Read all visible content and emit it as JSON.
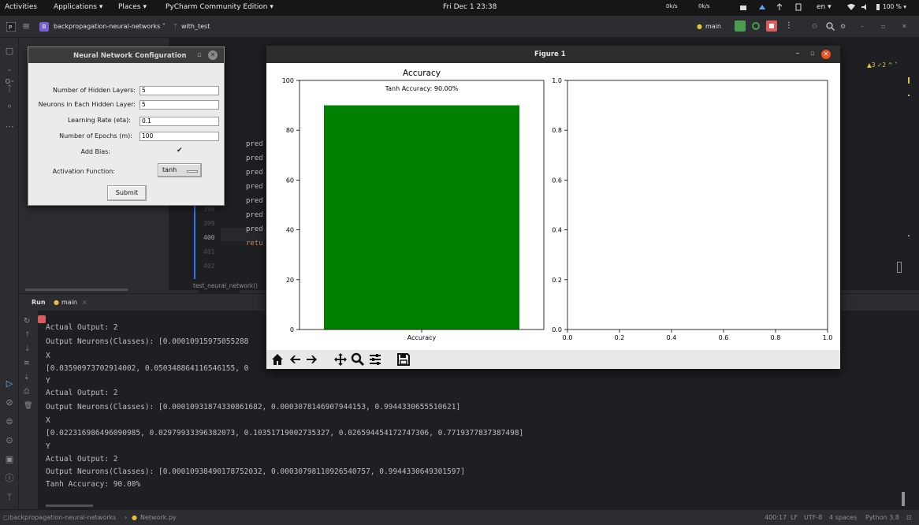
{
  "gnome_bar": {
    "activities": "Activities",
    "applications": "Applications ▾",
    "places": "Places ▾",
    "app": "PyCharm Community Edition ▾",
    "clock": "Fri Dec 1  23:38",
    "net_down": "0k/s",
    "net_up": "0k/s",
    "lang": "en ▾",
    "battery": "100 % ▾"
  },
  "toolbar": {
    "project": "backpropagation-neural-networks",
    "branch": "with_test",
    "run_config": "main",
    "project_badge": "B"
  },
  "editor": {
    "line_numbers": [
      "398",
      "399",
      "400",
      "401",
      "402"
    ],
    "code_lines": [
      "pred",
      "pred",
      "pred",
      "pred",
      "pred",
      "pred",
      "pred",
      "retu"
    ],
    "breadcrumb": "test_neural_network()",
    "inspection": "▲3 ✓2 ^ ˅"
  },
  "run_panel": {
    "run_label": "Run",
    "tab": "main",
    "lines": [
      "Actual Output:  2",
      "Output Neurons(Classes):  [0.00010915975055288",
      "X",
      "[0.03590973702914002, 0.050348864116546155, 0",
      "Y",
      "Actual Output:  2",
      "Output Neurons(Classes):  [0.00010931874330861682, 0.0003078146907944153, 0.9944330655510621]",
      "X",
      "[0.022316986496090985, 0.02979933396382073, 0.10351719002735327, 0.026594454172747306, 0.7719377837387498]",
      "Y",
      "Actual Output:  2",
      "Output Neurons(Classes):  [0.00010938490178752032, 0.00030798110926540757, 0.9944330649301597]",
      "Tanh Accuracy: 90.00%"
    ]
  },
  "status_bar": {
    "path_project": "backpropagation-neural-networks",
    "path_file": "Network.py",
    "position": "400:17",
    "line_sep": "LF",
    "encoding": "UTF-8",
    "indent": "4 spaces",
    "interpreter": "Python 3.8"
  },
  "nn_dialog": {
    "title": "Neural Network Configuration",
    "fields": [
      {
        "label": "Number of Hidden Layers:",
        "value": "5"
      },
      {
        "label": "Neurons in Each Hidden Layer:",
        "value": "5"
      },
      {
        "label": "Learning Rate (eta):",
        "value": "0.1"
      },
      {
        "label": "Number of Epochs (m):",
        "value": "100"
      }
    ],
    "bias_label": "Add Bias:",
    "bias_checked": true,
    "activation_label": "Activation Function:",
    "activation_value": "tanh",
    "submit_label": "Submit"
  },
  "figure": {
    "window_title": "Figure 1",
    "toolbar_icons": [
      "home-icon",
      "back-icon",
      "forward-icon",
      "pan-icon",
      "zoom-icon",
      "configure-icon",
      "save-icon"
    ]
  },
  "chart_data": [
    {
      "type": "bar",
      "title": "Accuracy",
      "subtitle": "Tanh Accuracy: 90.00%",
      "categories": [
        "Accuracy"
      ],
      "values": [
        90
      ],
      "color": "#008000",
      "ylim": [
        0,
        100
      ],
      "yticks": [
        0,
        20,
        40,
        60,
        80,
        100
      ],
      "grid": false
    },
    {
      "type": "line",
      "title": "",
      "xlim": [
        0.0,
        1.0
      ],
      "ylim": [
        0.0,
        1.0
      ],
      "xticks": [
        "0.0",
        "0.2",
        "0.4",
        "0.6",
        "0.8",
        "1.0"
      ],
      "yticks": [
        "0.0",
        "0.2",
        "0.4",
        "0.6",
        "0.8",
        "1.0"
      ],
      "series": [],
      "grid": false
    }
  ],
  "colors": {
    "ide_bg": "#2b2d30",
    "editor_bg": "#1e1f22",
    "bar_green": "#008000",
    "accent_blue": "#3574f0"
  }
}
